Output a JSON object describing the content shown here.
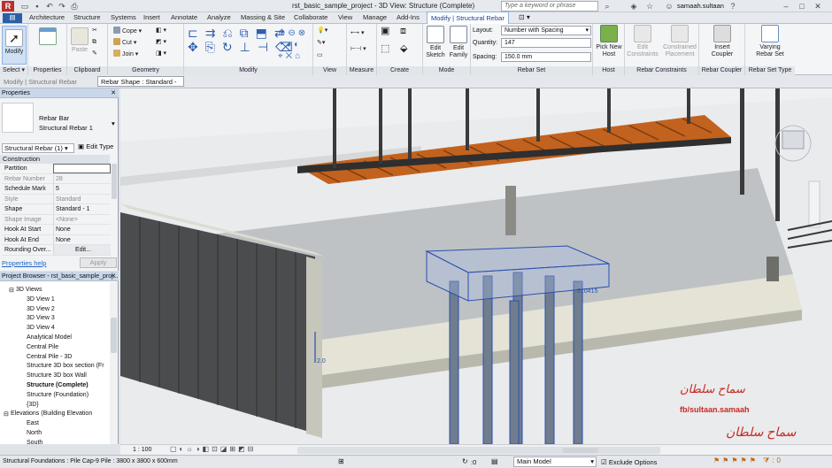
{
  "title_bar": {
    "title": "rst_basic_sample_project - 3D View: Structure (Complete)",
    "search_placeholder": "Type a keyword or phrase",
    "user": "samaah.sultaan"
  },
  "tabs": [
    "Architecture",
    "Structure",
    "Systems",
    "Insert",
    "Annotate",
    "Analyze",
    "Massing & Site",
    "Collaborate",
    "View",
    "Manage",
    "Add-Ins",
    "Modify | Structural Rebar"
  ],
  "ribbon": {
    "select": {
      "button": "Modify",
      "label": "Select"
    },
    "properties": {
      "label": "Properties"
    },
    "clipboard": {
      "paste": "Paste",
      "label": "Clipboard"
    },
    "geometry": {
      "cope": "Cope",
      "cut": "Cut",
      "join": "Join",
      "label": "Geometry"
    },
    "modify": {
      "label": "Modify"
    },
    "view": {
      "label": "View"
    },
    "measure": {
      "label": "Measure"
    },
    "create": {
      "label": "Create"
    },
    "mode": {
      "edit_sketch": "Edit Sketch",
      "edit_family": "Edit Family",
      "label": "Mode"
    },
    "rebar_set": {
      "layout_label": "Layout:",
      "layout_value": "Number with Spacing",
      "quantity_label": "Quantity:",
      "quantity_value": "147",
      "spacing_label": "Spacing:",
      "spacing_value": "150.0 mm",
      "label": "Rebar Set"
    },
    "host": {
      "pick": "Pick New Host",
      "label": "Host"
    },
    "rebar_constraints": {
      "edit": "Edit Constraints",
      "constrained": "Constrained Placement",
      "label": "Rebar Constraints"
    },
    "rebar_coupler": {
      "insert": "Insert Coupler",
      "label": "Rebar Coupler"
    },
    "rebar_set_type": {
      "varying": "Varying Rebar Set",
      "label": "Rebar Set Type"
    }
  },
  "options_bar": {
    "context": "Modify | Structural Rebar",
    "rebar_shape_label": "Rebar Shape : Standard -"
  },
  "properties": {
    "header": "Properties",
    "type_name": "Rebar Bar",
    "type_sub": "Structural Rebar 1",
    "selector": "Structural Rebar (1)",
    "edit_type": "Edit Type",
    "group": "Construction",
    "rows": [
      {
        "k": "Partition",
        "v": ""
      },
      {
        "k": "Rebar Number",
        "v": "28"
      },
      {
        "k": "Schedule Mark",
        "v": "5"
      },
      {
        "k": "Style",
        "v": "Standard"
      },
      {
        "k": "Shape",
        "v": "Standard - 1"
      },
      {
        "k": "Shape Image",
        "v": "<None>"
      },
      {
        "k": "Hook At Start",
        "v": "None"
      },
      {
        "k": "Hook At End",
        "v": "None"
      },
      {
        "k": "Rounding Over...",
        "v": "Edit..."
      }
    ],
    "help": "Properties help",
    "apply": "Apply"
  },
  "browser": {
    "header": "Project Browser - rst_basic_sample_proj...",
    "items": [
      "3D Views",
      "3D View 1",
      "3D View 2",
      "3D View 3",
      "3D View 4",
      "Analytical Model",
      "Central Pile",
      "Central Pile - 3D",
      "Structure 3D box section (Fr",
      "Structure 3D box Wall",
      "Structure (Complete)",
      "Structure (Foundation)",
      "{3D}",
      "Elevations (Building Elevation",
      "East",
      "North",
      "South"
    ]
  },
  "viewport": {
    "dim_text": "2.0",
    "rebar_tag": "210415",
    "scale": "1 : 100"
  },
  "watermark": {
    "line1": "سماح سلطان",
    "line2": "fb/sultaan.samaah",
    "line3": "سماح سلطان"
  },
  "status": {
    "text": "Structural Foundations : Pile Cap-9 Pile : 3800 x 3800 x 600mm",
    "zero": ":0",
    "model": "Main Model",
    "exclude": "Exclude Options"
  },
  "colors": {
    "accent": "#1e64c8",
    "deck": "#c2621f",
    "steel": "#3a3a3a",
    "wall": "#4a4c4e",
    "rebar": "#2a4fb0"
  }
}
